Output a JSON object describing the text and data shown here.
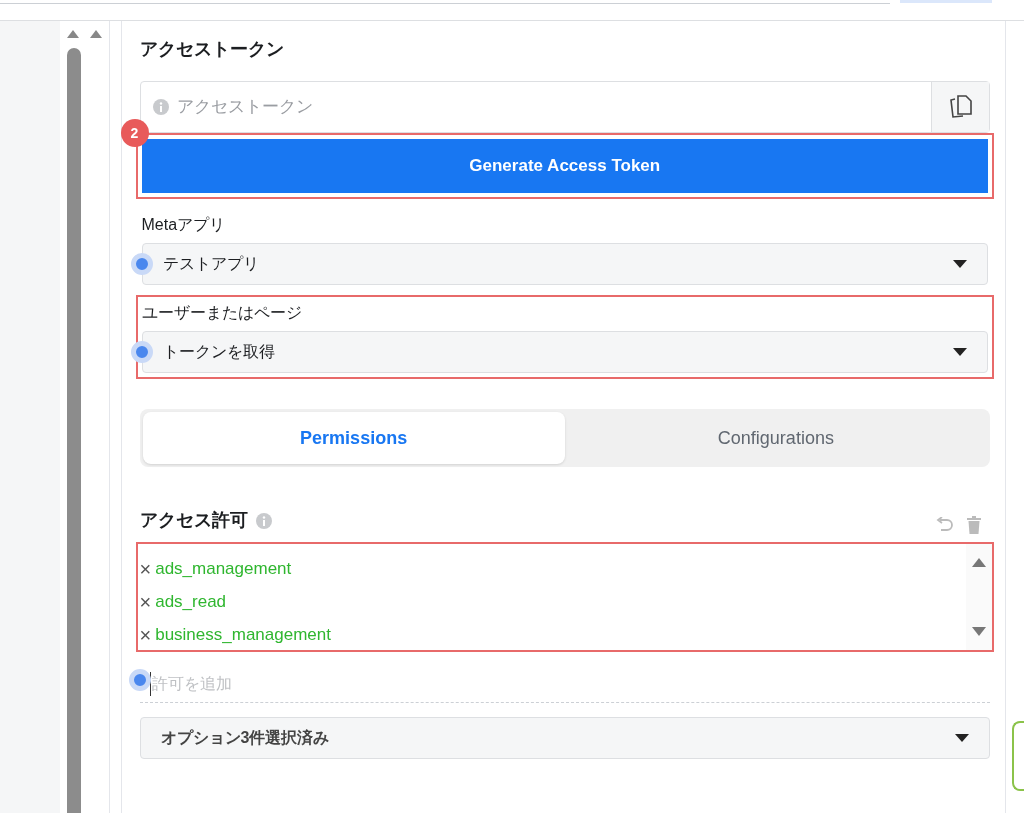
{
  "access_token": {
    "title": "アクセストークン",
    "placeholder": "アクセストークン",
    "step_badge": "2",
    "generate_button": "Generate Access Token",
    "highlighted": true
  },
  "meta_app": {
    "label": "Metaアプリ",
    "value": "テストアプリ",
    "marker": true,
    "highlighted": false
  },
  "user_or_page": {
    "label": "ユーザーまたはページ",
    "value": "トークンを取得",
    "marker": true,
    "highlighted": true
  },
  "tabs": [
    {
      "label": "Permissions",
      "selected": true
    },
    {
      "label": "Configurations",
      "selected": false
    }
  ],
  "permissions": {
    "title": "アクセス許可",
    "highlighted": true,
    "items": [
      {
        "remove": "×",
        "name": "ads_management"
      },
      {
        "remove": "×",
        "name": "ads_read"
      },
      {
        "remove": "×",
        "name": "business_management"
      }
    ],
    "add_placeholder": "許可を追加",
    "add_marker": true,
    "summary": "オプション3件選択済み"
  }
}
